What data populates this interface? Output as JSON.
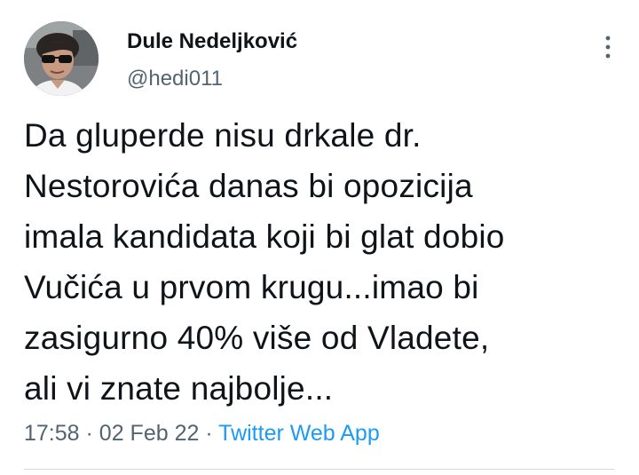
{
  "author": {
    "display_name": "Dule Nedeljković",
    "handle": "@hedi011"
  },
  "tweet": {
    "text": "Da gluperde nisu drkale dr.\nNestorovića danas bi opozicija\nimala kandidata koji bi glat dobio\nVučića u prvom krugu...imao bi\nzasigurno 40% više od Vladete,\nali vi znate najbolje...",
    "time": "17:58",
    "date": "02 Feb 22",
    "separator": "·",
    "source": "Twitter Web App"
  },
  "icons": {
    "more": "more-vertical-icon"
  },
  "colors": {
    "text": "#0f1419",
    "secondary": "#536471",
    "link": "#1d9bf0",
    "divider": "#cfd9de"
  }
}
